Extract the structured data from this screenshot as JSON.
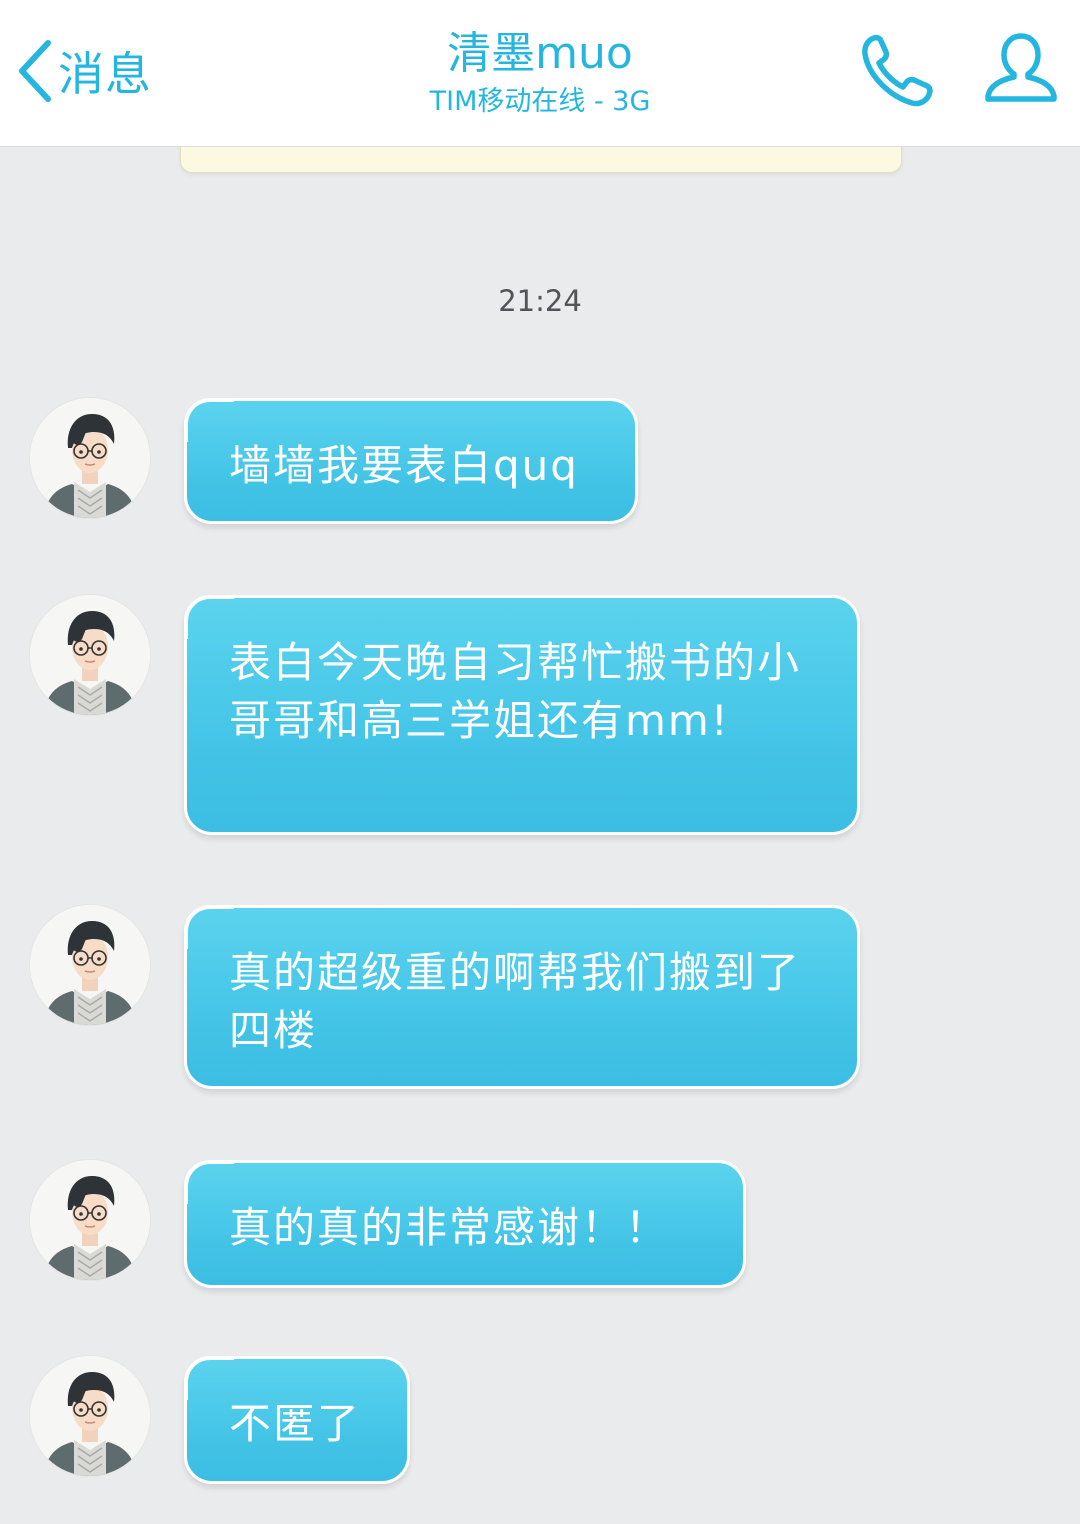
{
  "header": {
    "back_label": "消息",
    "contact_name": "清墨muo",
    "status": "TIM移动在线 - 3G",
    "icons": {
      "back": "chevron-left-icon",
      "call": "phone-icon",
      "profile": "profile-icon"
    }
  },
  "timestamp": "21:24",
  "messages": [
    {
      "text": "墙墙我要表白quq"
    },
    {
      "text": "表白今天晚自习帮忙搬书的小哥哥和高三学姐还有mm!"
    },
    {
      "text": "真的超级重的啊帮我们搬到了四楼"
    },
    {
      "text": "真的真的非常感谢！！"
    },
    {
      "text": "不匿了"
    }
  ],
  "colors": {
    "accent": "#25b6e0",
    "bubble": "#4cc8ea",
    "background": "#eaebed",
    "header_bg": "#ffffff",
    "card_bg": "#fbf9e0"
  }
}
